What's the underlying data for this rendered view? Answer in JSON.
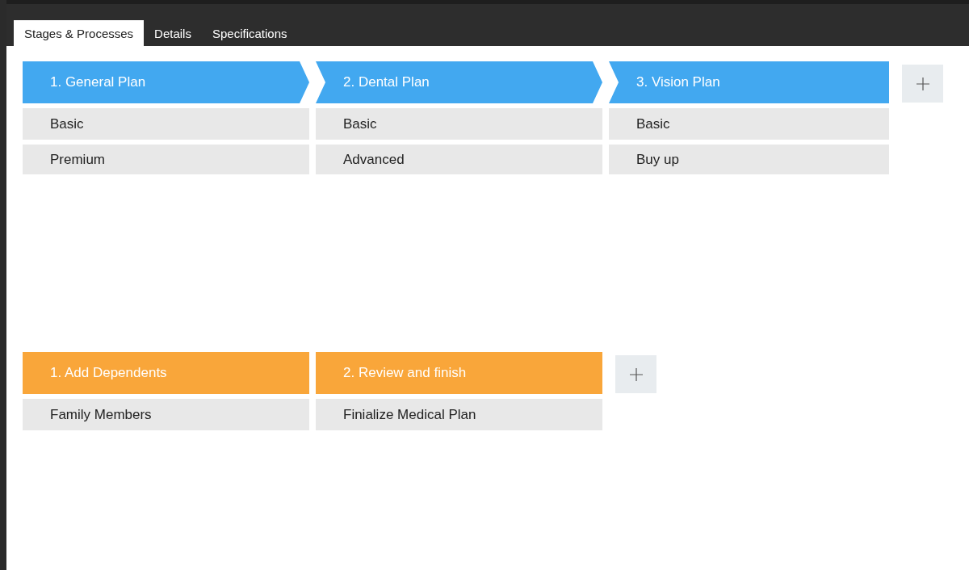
{
  "tabs": [
    {
      "label": "Stages & Processes",
      "selected": true
    },
    {
      "label": "Details",
      "selected": false
    },
    {
      "label": "Specifications",
      "selected": false
    }
  ],
  "pipelines": [
    {
      "kind": "chevron",
      "color": "#42a8f0",
      "stages": [
        {
          "title": "1. General Plan",
          "steps": [
            "Basic",
            "Premium"
          ]
        },
        {
          "title": "2. Dental Plan",
          "steps": [
            "Basic",
            "Advanced"
          ]
        },
        {
          "title": "3. Vision Plan",
          "steps": [
            "Basic",
            "Buy up"
          ]
        }
      ]
    },
    {
      "kind": "flat",
      "color": "#f9a63a",
      "stages": [
        {
          "title": "1. Add Dependents",
          "steps": [
            "Family Members"
          ]
        },
        {
          "title": "2. Review and finish",
          "steps": [
            "Finialize Medical Plan"
          ]
        }
      ]
    }
  ]
}
